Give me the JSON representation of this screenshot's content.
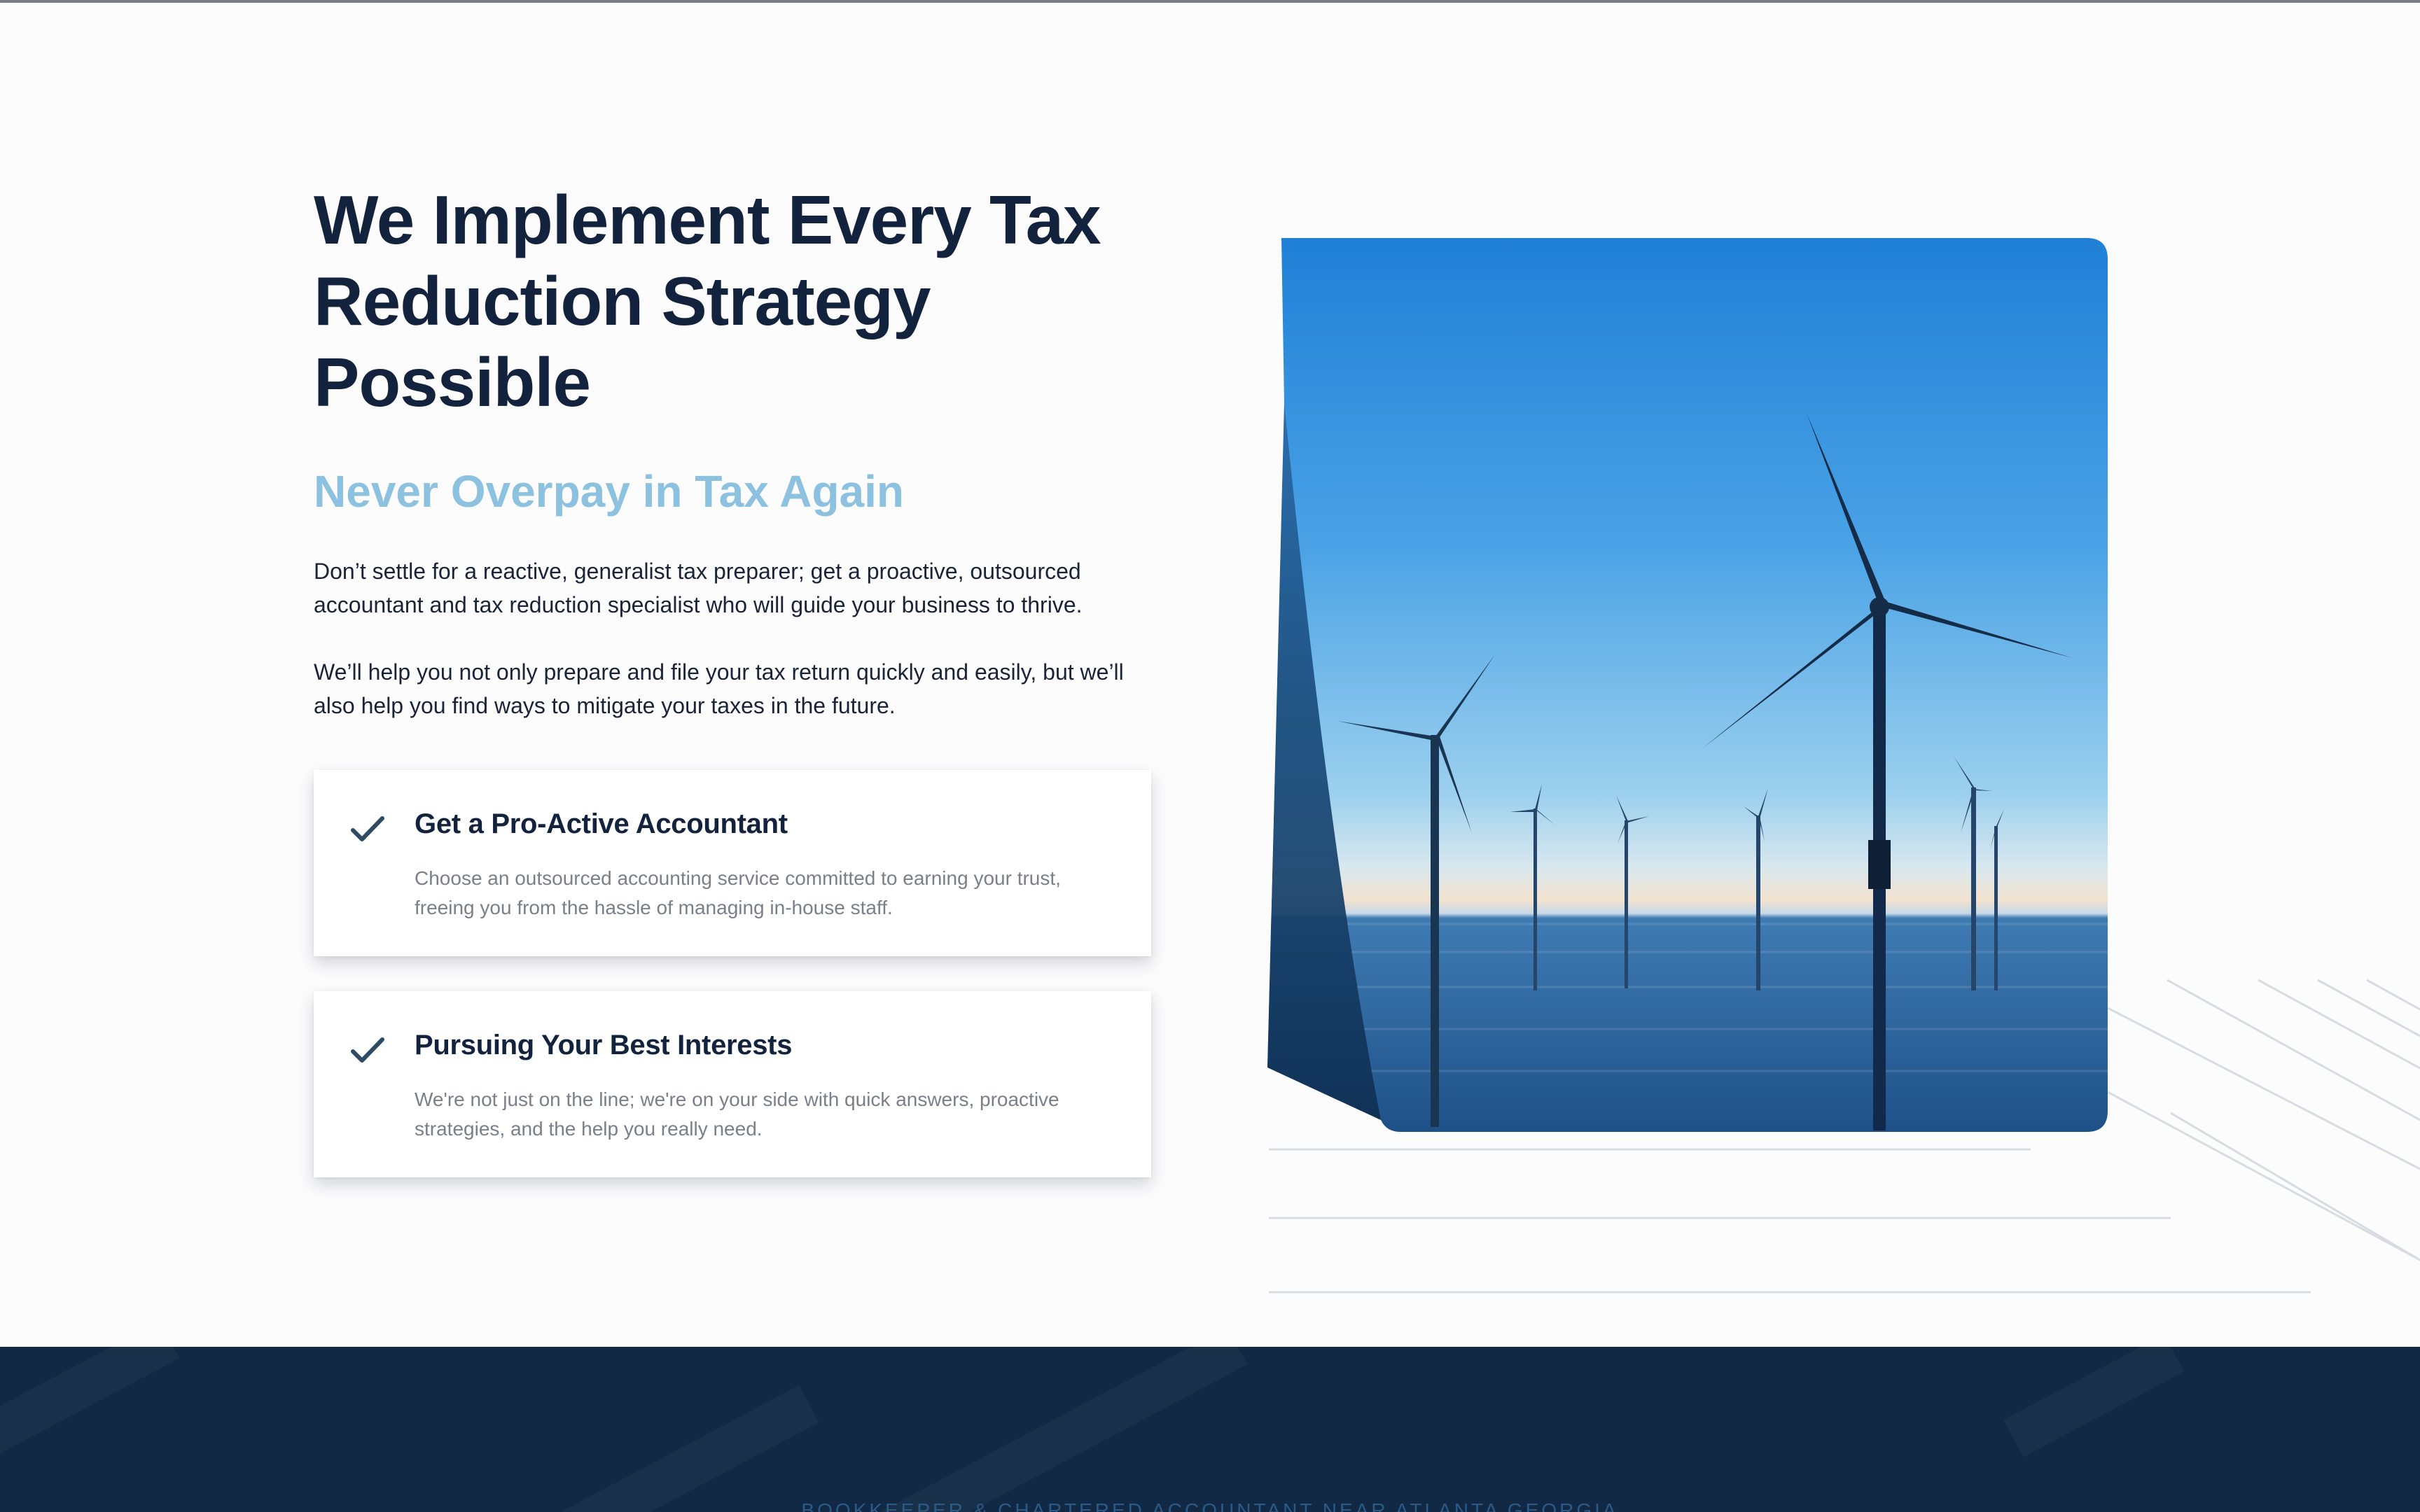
{
  "hero": {
    "title": "We Implement Every Tax Reduction Strategy Possible",
    "subtitle": "Never Overpay in Tax Again",
    "paragraphs": [
      "Don’t settle for a reactive, generalist tax preparer; get a proactive, outsourced accountant and tax reduction specialist who will guide your business to thrive.",
      "We’ll help you not only prepare and file your tax return quickly and easily, but we’ll also help you find ways to mitigate your taxes in the future."
    ]
  },
  "features": [
    {
      "icon": "check-icon",
      "title": "Get a Pro-Active Accountant",
      "description": "Choose an outsourced accounting service committed to earning your trust, freeing you from the hassle of managing in-house staff."
    },
    {
      "icon": "check-icon",
      "title": "Pursuing Your Best Interests",
      "description": "We're not just on the line; we're on your side with quick answers, proactive strategies, and the help you really need."
    }
  ],
  "hero_image": {
    "subject": "offshore wind turbines at sea"
  },
  "footer": {
    "caption": "BOOKKEEPER & CHARTERED ACCOUNTANT NEAR ATLANTA GEORGIA"
  },
  "colors": {
    "heading": "#13233d",
    "subtitle": "#8dc1e0",
    "footer_bg": "#112944",
    "check": "#2f4a63"
  }
}
